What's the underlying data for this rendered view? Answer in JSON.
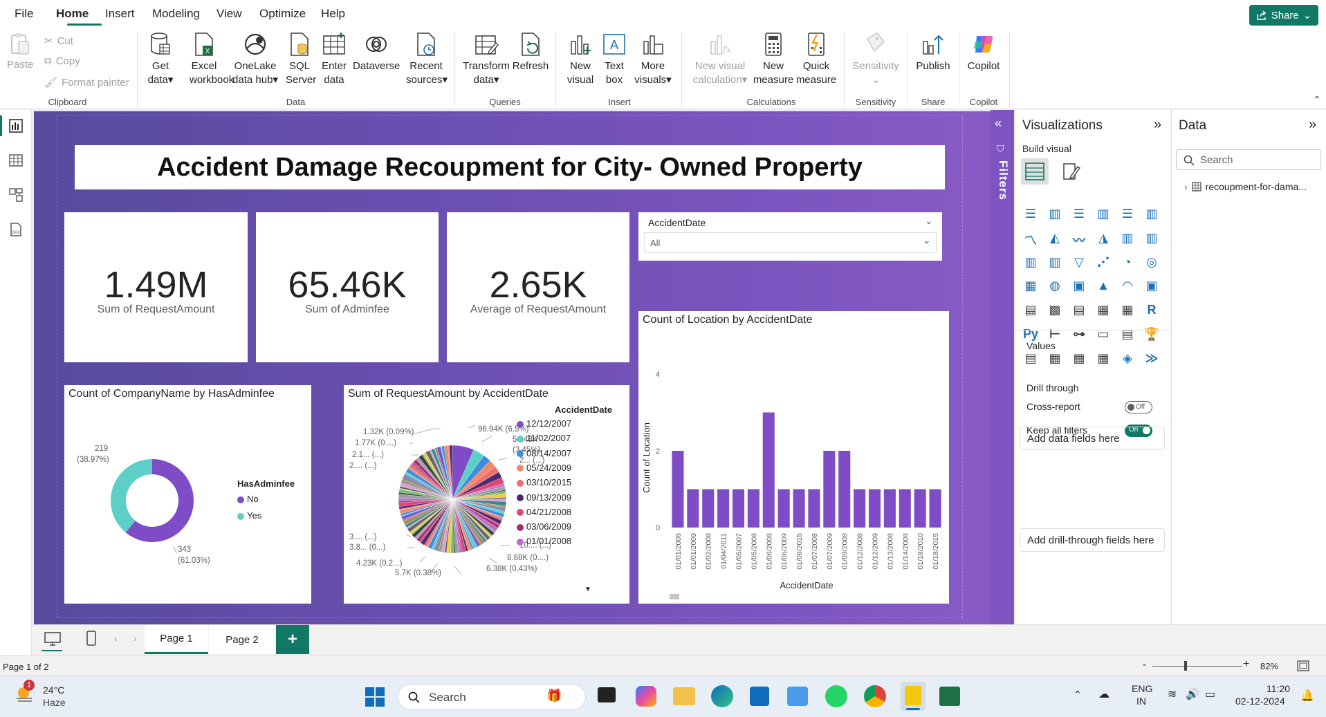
{
  "menu": {
    "file": "File",
    "home": "Home",
    "insert": "Insert",
    "modeling": "Modeling",
    "view": "View",
    "optimize": "Optimize",
    "help": "Help",
    "share": "Share"
  },
  "ribbon": {
    "clipboard": {
      "paste": "Paste",
      "cut": "Cut",
      "copy": "Copy",
      "format_painter": "Format painter",
      "label": "Clipboard"
    },
    "data": {
      "get_data_1": "Get",
      "get_data_2": "data",
      "excel_1": "Excel",
      "excel_2": "workbook",
      "onelake_1": "OneLake",
      "onelake_2": "data hub",
      "sql_1": "SQL",
      "sql_2": "Server",
      "enter_1": "Enter",
      "enter_2": "data",
      "dataverse": "Dataverse",
      "recent_1": "Recent",
      "recent_2": "sources",
      "label": "Data"
    },
    "queries": {
      "transform_1": "Transform",
      "transform_2": "data",
      "refresh": "Refresh",
      "label": "Queries"
    },
    "insert": {
      "new_visual_1": "New",
      "new_visual_2": "visual",
      "text_box_1": "Text",
      "text_box_2": "box",
      "more_visuals_1": "More",
      "more_visuals_2": "visuals",
      "label": "Insert"
    },
    "calculations": {
      "new_visual_calc_1": "New visual",
      "new_visual_calc_2": "calculation",
      "new_measure_1": "New",
      "new_measure_2": "measure",
      "quick_measure_1": "Quick",
      "quick_measure_2": "measure",
      "label": "Calculations"
    },
    "sensitivity": {
      "btn": "Sensitivity",
      "label": "Sensitivity"
    },
    "share": {
      "publish": "Publish",
      "label": "Share"
    },
    "copilot": {
      "btn": "Copilot",
      "label": "Copilot"
    }
  },
  "report": {
    "title": "Accident Damage Recoupment for City- Owned Property",
    "kpis": [
      {
        "value": "1.49M",
        "label": "Sum of RequestAmount"
      },
      {
        "value": "65.46K",
        "label": "Sum of Adminfee"
      },
      {
        "value": "2.65K",
        "label": "Average of RequestAmount"
      }
    ],
    "slicer": {
      "title": "AccidentDate",
      "value": "All"
    },
    "donut": {
      "title": "Count of CompanyName by HasAdminfee",
      "legend_title": "HasAdminfee",
      "legend": [
        {
          "name": "No",
          "color": "#7e4cc7"
        },
        {
          "name": "Yes",
          "color": "#5ecfc7"
        }
      ],
      "label_yes_1": "219",
      "label_yes_2": "(38.97%)",
      "label_no_1": "343",
      "label_no_2": "(61.03%)"
    },
    "pie": {
      "title": "Sum of RequestAmount by AccidentDate",
      "legend_title": "AccidentDate",
      "legend": [
        {
          "name": "12/12/2007",
          "color": "#7e4cc7"
        },
        {
          "name": "11/02/2007",
          "color": "#5ecfc7"
        },
        {
          "name": "08/14/2007",
          "color": "#3b8de0"
        },
        {
          "name": "05/24/2009",
          "color": "#f08a6a"
        },
        {
          "name": "03/10/2015",
          "color": "#ef6f6f"
        },
        {
          "name": "09/13/2009",
          "color": "#4a2a6e"
        },
        {
          "name": "04/21/2008",
          "color": "#e0457a"
        },
        {
          "name": "03/06/2009",
          "color": "#a0306a"
        },
        {
          "name": "01/01/2008",
          "color": "#c26ad4"
        }
      ],
      "labels": {
        "l1": "96.94K (6.5%)",
        "l2": "51.48K",
        "l3": "(3.45%)",
        "l4": "2... (...)",
        "l5": "1.32K (0.09%)",
        "l6": "1.77K (0....)",
        "l7": "2.1... (...)",
        "l8": "2.... (...)",
        "l9": "3.... (...)",
        "l10": "3.8... (0...)",
        "l11": "4.23K (0.2...)",
        "l12": "5.7K (0.38%)",
        "l13": "6.38K (0.43%)",
        "l14": "8.68K (0....)",
        "l15": "10.... (...)"
      }
    },
    "bar": {
      "title": "Count of Location by AccidentDate"
    }
  },
  "chart_data": [
    {
      "type": "bar",
      "title": "Count of Location by AccidentDate",
      "xlabel": "AccidentDate",
      "ylabel": "Count of Location",
      "ylim": [
        0,
        4
      ],
      "yticks": [
        "0",
        "2",
        "4"
      ],
      "categories": [
        "01/01/2008",
        "01/01/2009",
        "01/02/2008",
        "01/04/2011",
        "01/05/2007",
        "01/05/2008",
        "01/06/2008",
        "01/06/2009",
        "01/06/2015",
        "01/07/2008",
        "01/07/2009",
        "01/09/2008",
        "01/12/2008",
        "01/12/2009",
        "01/13/2008",
        "01/14/2008",
        "01/18/2010",
        "01/18/2015"
      ],
      "values": [
        2,
        1,
        1,
        1,
        1,
        1,
        3,
        1,
        1,
        1,
        2,
        2,
        1,
        1,
        1,
        1,
        1,
        1
      ],
      "color": "#7e4cc7"
    },
    {
      "type": "pie",
      "title": "Count of CompanyName by HasAdminfee",
      "categories": [
        "No",
        "Yes"
      ],
      "values": [
        343,
        219
      ]
    }
  ],
  "filters": {
    "label": "Filters"
  },
  "viz_pane": {
    "title": "Visualizations",
    "build": "Build visual",
    "values": "Values",
    "add_fields": "Add data fields here",
    "drill": "Drill through",
    "cross_report": "Cross-report",
    "cross_state": "Off",
    "keep_filters": "Keep all filters",
    "keep_state": "On",
    "add_drill": "Add drill-through fields here",
    "more": "..."
  },
  "data_pane": {
    "title": "Data",
    "search_placeholder": "Search",
    "table": "recoupment-for-dama..."
  },
  "pages": {
    "page1": "Page 1",
    "page2": "Page 2",
    "add": "+"
  },
  "status": {
    "page_info": "Page 1 of 2",
    "zoom": "82%"
  },
  "taskbar": {
    "temp": "24°C",
    "weather": "Haze",
    "search": "Search",
    "lang_1": "ENG",
    "lang_2": "IN",
    "time": "11:20",
    "date": "02-12-2024",
    "badge": "1"
  }
}
